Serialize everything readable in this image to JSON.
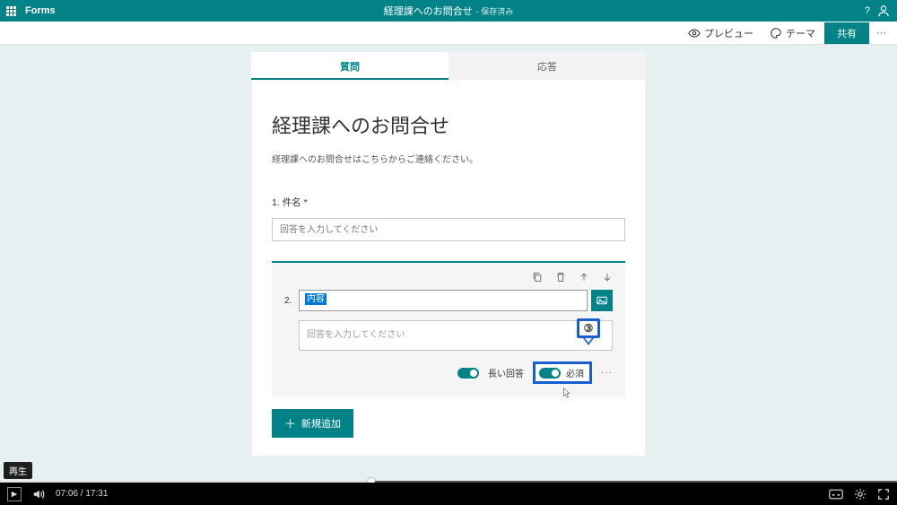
{
  "appbar": {
    "brand": "Forms",
    "form_title": "経理課へのお問合せ",
    "saved_suffix": "- 保存済み"
  },
  "cmdbar": {
    "preview": "プレビュー",
    "theme": "テーマ",
    "share": "共有"
  },
  "tabs": {
    "questions": "質問",
    "responses": "応答"
  },
  "form": {
    "title": "経理課へのお問合せ",
    "description": "経理課へのお問合せはこちらからご連絡ください。",
    "q1": {
      "num": "1.",
      "label": "件名",
      "required_mark": "*",
      "placeholder": "回答を入力してください"
    },
    "q2": {
      "num": "2.",
      "name_value": "内容",
      "answer_placeholder": "回答を入力してください",
      "long_answer_label": "長い回答",
      "required_label": "必須",
      "more": "···"
    },
    "callout_label": "③",
    "add_new": "新規追加",
    "add_plus": "＋"
  },
  "replay_badge": "再生",
  "player": {
    "current": "07:06",
    "sep": " / ",
    "total": "17:31"
  }
}
